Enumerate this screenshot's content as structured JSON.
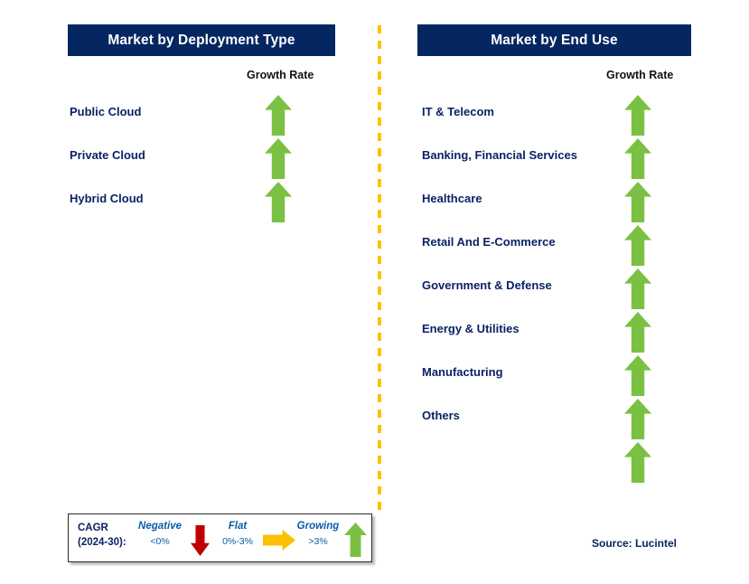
{
  "left_panel": {
    "title": "Market by Deployment Type",
    "growth_rate_label": "Growth Rate",
    "rows": [
      {
        "label": "Public Cloud",
        "trend": "growing",
        "trend_icon": "arrow-up-icon"
      },
      {
        "label": "Private Cloud",
        "trend": "growing",
        "trend_icon": "arrow-up-icon"
      },
      {
        "label": "Hybrid Cloud",
        "trend": "growing",
        "trend_icon": "arrow-up-icon"
      }
    ]
  },
  "right_panel": {
    "title": "Market by End Use",
    "growth_rate_label": "Growth Rate",
    "rows": [
      {
        "label": "IT & Telecom",
        "trend": "growing",
        "trend_icon": "arrow-up-icon"
      },
      {
        "label": "Banking, Financial Services",
        "trend": "growing",
        "trend_icon": "arrow-up-icon"
      },
      {
        "label": "Healthcare",
        "trend": "growing",
        "trend_icon": "arrow-up-icon"
      },
      {
        "label": "Retail And E-Commerce",
        "trend": "growing",
        "trend_icon": "arrow-up-icon"
      },
      {
        "label": "Government & Defense",
        "trend": "growing",
        "trend_icon": "arrow-up-icon"
      },
      {
        "label": "Energy & Utilities",
        "trend": "growing",
        "trend_icon": "arrow-up-icon"
      },
      {
        "label": "Manufacturing",
        "trend": "growing",
        "trend_icon": "arrow-up-icon"
      },
      {
        "label": "Others",
        "trend": "growing",
        "trend_icon": "arrow-up-icon"
      },
      {
        "label": "",
        "trend": "growing",
        "trend_icon": "arrow-up-icon"
      }
    ]
  },
  "legend": {
    "cagr_line1": "CAGR",
    "cagr_line2": "(2024-30):",
    "entries": [
      {
        "title": "Negative",
        "value": "<0%",
        "icon": "arrow-down-icon",
        "color": "#c00000"
      },
      {
        "title": "Flat",
        "value": "0%-3%",
        "icon": "arrow-right-icon",
        "color": "#ffc000"
      },
      {
        "title": "Growing",
        "value": ">3%",
        "icon": "arrow-up-icon",
        "color": "#7ac143"
      }
    ]
  },
  "source": "Source: Lucintel",
  "colors": {
    "header_bar": "#042661",
    "label_text": "#0b2265",
    "growth_arrow": "#7ac143",
    "negative_arrow": "#c00000",
    "flat_arrow": "#ffc000",
    "divider": "#ffc000"
  }
}
